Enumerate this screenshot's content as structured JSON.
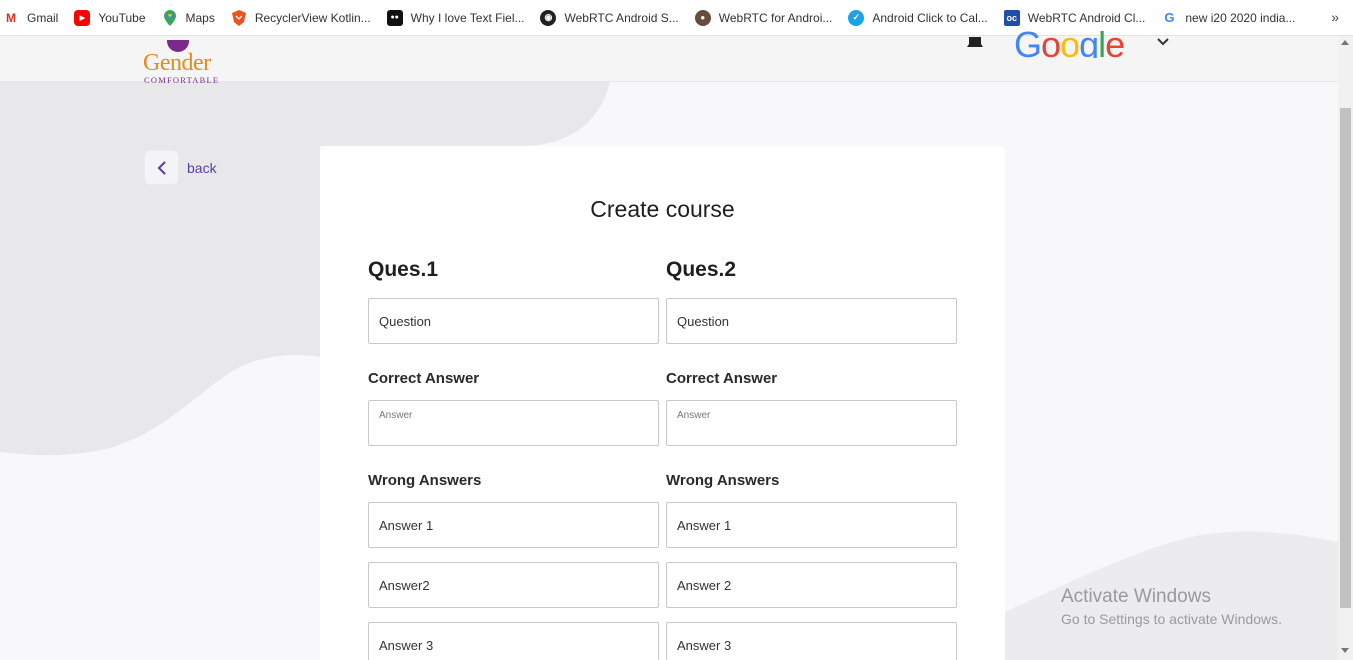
{
  "bookmarks": {
    "items": [
      {
        "label": "Gmail",
        "icon": "gmail-icon",
        "color": "#d93025",
        "glyph": "M"
      },
      {
        "label": "YouTube",
        "icon": "youtube-icon",
        "color": "#ff0000",
        "glyph": "▶"
      },
      {
        "label": "Maps",
        "icon": "maps-pin-icon",
        "color": "#34a853",
        "glyph": "●"
      },
      {
        "label": "RecyclerView Kotlin...",
        "icon": "brave-shield-icon",
        "color": "#e8531e",
        "glyph": "◆"
      },
      {
        "label": "Why I love Text Fiel...",
        "icon": "medium-icon",
        "color": "#111111",
        "glyph": "●●"
      },
      {
        "label": "WebRTC Android S...",
        "icon": "github-icon",
        "color": "#222222",
        "glyph": "◉"
      },
      {
        "label": "WebRTC for Androi...",
        "icon": "avatar-icon",
        "color": "#6b4b3a",
        "glyph": "●"
      },
      {
        "label": "Android Click to Cal...",
        "icon": "app-icon",
        "color": "#1aa3e8",
        "glyph": "✓"
      },
      {
        "label": "WebRTC Android Cl...",
        "icon": "cc-icon",
        "color": "#1f4fa8",
        "glyph": "oc"
      },
      {
        "label": "new i20 2020 india...",
        "icon": "google-icon",
        "color": "#4285f4",
        "glyph": "G"
      }
    ],
    "more": "»"
  },
  "header": {
    "logo_main": "Gender",
    "logo_sub": "COMFORTABLE",
    "google_letters": [
      "G",
      "o",
      "o",
      "g",
      "l",
      "e"
    ],
    "google_colors": [
      "#4285f4",
      "#ea4335",
      "#fbbc05",
      "#4285f4",
      "#34a853",
      "#ea4335"
    ]
  },
  "back": {
    "label": "back"
  },
  "card": {
    "title": "Create course",
    "columns": [
      {
        "ques_title": "Ques.1",
        "question_value": "Question",
        "correct_label": "Correct Answer",
        "correct_value": "Answer",
        "wrong_label": "Wrong Answers",
        "wrong_values": [
          "Answer 1",
          "Answer2",
          "Answer 3"
        ]
      },
      {
        "ques_title": "Ques.2",
        "question_value": "Question",
        "correct_label": "Correct Answer",
        "correct_value": "Answer",
        "wrong_label": "Wrong Answers",
        "wrong_values": [
          "Answer 1",
          "Answer 2",
          "Answer 3"
        ]
      }
    ]
  },
  "watermark": {
    "line1": "Activate Windows",
    "line2": "Go to Settings to activate Windows."
  }
}
